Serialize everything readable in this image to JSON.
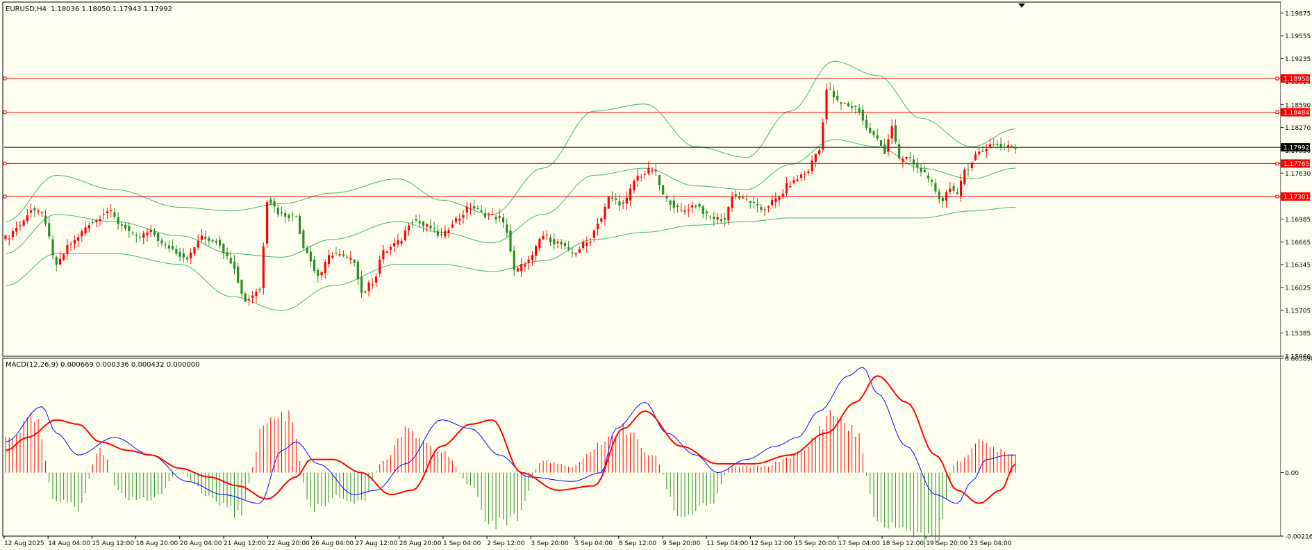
{
  "chart_data": [
    {
      "type": "candlestick",
      "title": "EURUSD,H4",
      "ohlc_readout": "1.18036 1.18050 1.17943 1.17992",
      "current_price": "1.17992",
      "y_tick_labels": [
        "1.19875",
        "1.19555",
        "1.19235",
        "1.18915",
        "1.18590",
        "1.18270",
        "1.17950",
        "1.17630",
        "1.17310",
        "1.16985",
        "1.16665",
        "1.16345",
        "1.16025",
        "1.15705",
        "1.15385",
        "1.15060"
      ],
      "ylim": [
        1.1506,
        1.2003
      ],
      "x_tick_labels": [
        "12 Aug 2025",
        "14 Aug 04:00",
        "15 Aug 12:00",
        "18 Aug 20:00",
        "20 Aug 04:00",
        "21 Aug 12:00",
        "22 Aug 20:00",
        "26 Aug 04:00",
        "27 Aug 12:00",
        "28 Aug 20:00",
        "1 Sep 04:00",
        "2 Sep 12:00",
        "3 Sep 20:00",
        "5 Sep 04:00",
        "8 Sep 12:00",
        "9 Sep 20:00",
        "11 Sep 04:00",
        "12 Sep 12:00",
        "15 Sep 20:00",
        "17 Sep 04:00",
        "18 Sep 12:00",
        "19 Sep 20:00",
        "23 Sep 04:00"
      ],
      "horizontal_lines": [
        {
          "value": 1.18958,
          "label": "1.18958",
          "color": "#ff0000"
        },
        {
          "value": 1.18484,
          "label": "1.18484",
          "color": "#ff0000"
        },
        {
          "value": 1.17765,
          "label": "1.17765",
          "color": "#ff0000"
        },
        {
          "value": 1.17301,
          "label": "1.17301",
          "color": "#ff0000"
        }
      ],
      "bollinger_anchor_mid": [
        [
          0,
          1.165
        ],
        [
          14,
          1.1705
        ],
        [
          30,
          1.1695
        ],
        [
          48,
          1.1675
        ],
        [
          62,
          1.165
        ],
        [
          76,
          1.1645
        ],
        [
          90,
          1.167
        ],
        [
          108,
          1.1695
        ],
        [
          120,
          1.168
        ],
        [
          134,
          1.1665
        ],
        [
          148,
          1.1705
        ],
        [
          162,
          1.176
        ],
        [
          176,
          1.177
        ],
        [
          190,
          1.1745
        ],
        [
          204,
          1.174
        ],
        [
          216,
          1.1775
        ],
        [
          228,
          1.181
        ],
        [
          240,
          1.18
        ],
        [
          252,
          1.177
        ],
        [
          266,
          1.1755
        ],
        [
          278,
          1.177
        ]
      ],
      "bollinger_anchor_width": [
        [
          0,
          0.0045
        ],
        [
          14,
          0.0055
        ],
        [
          30,
          0.0045
        ],
        [
          48,
          0.004
        ],
        [
          62,
          0.006
        ],
        [
          76,
          0.0075
        ],
        [
          90,
          0.0065
        ],
        [
          108,
          0.006
        ],
        [
          120,
          0.0045
        ],
        [
          134,
          0.004
        ],
        [
          148,
          0.0065
        ],
        [
          162,
          0.009
        ],
        [
          176,
          0.009
        ],
        [
          190,
          0.0055
        ],
        [
          204,
          0.0045
        ],
        [
          216,
          0.0075
        ],
        [
          228,
          0.011
        ],
        [
          240,
          0.01
        ],
        [
          252,
          0.007
        ],
        [
          266,
          0.0045
        ],
        [
          278,
          0.0055
        ]
      ],
      "close_anchors": [
        [
          0,
          1.1672
        ],
        [
          4,
          1.169
        ],
        [
          7,
          1.1712
        ],
        [
          10,
          1.1705
        ],
        [
          14,
          1.1635
        ],
        [
          18,
          1.1665
        ],
        [
          24,
          1.1695
        ],
        [
          28,
          1.171
        ],
        [
          32,
          1.169
        ],
        [
          36,
          1.1672
        ],
        [
          40,
          1.168
        ],
        [
          44,
          1.166
        ],
        [
          50,
          1.1645
        ],
        [
          54,
          1.1672
        ],
        [
          58,
          1.1668
        ],
        [
          62,
          1.164
        ],
        [
          66,
          1.1585
        ],
        [
          70,
          1.16
        ],
        [
          72,
          1.1726
        ],
        [
          76,
          1.1705
        ],
        [
          80,
          1.1702
        ],
        [
          82,
          1.166
        ],
        [
          86,
          1.162
        ],
        [
          90,
          1.165
        ],
        [
          96,
          1.164
        ],
        [
          98,
          1.1595
        ],
        [
          101,
          1.161
        ],
        [
          104,
          1.1652
        ],
        [
          108,
          1.1665
        ],
        [
          112,
          1.1698
        ],
        [
          116,
          1.1688
        ],
        [
          120,
          1.1675
        ],
        [
          124,
          1.1698
        ],
        [
          128,
          1.1715
        ],
        [
          132,
          1.1705
        ],
        [
          136,
          1.17
        ],
        [
          138,
          1.1682
        ],
        [
          140,
          1.1625
        ],
        [
          144,
          1.164
        ],
        [
          148,
          1.1675
        ],
        [
          152,
          1.1665
        ],
        [
          156,
          1.165
        ],
        [
          160,
          1.1665
        ],
        [
          164,
          1.17
        ],
        [
          166,
          1.1728
        ],
        [
          170,
          1.172
        ],
        [
          174,
          1.1758
        ],
        [
          178,
          1.1768
        ],
        [
          182,
          1.1725
        ],
        [
          186,
          1.171
        ],
        [
          190,
          1.1718
        ],
        [
          194,
          1.17
        ],
        [
          198,
          1.1698
        ],
        [
          200,
          1.1732
        ],
        [
          204,
          1.1725
        ],
        [
          208,
          1.1712
        ],
        [
          212,
          1.1725
        ],
        [
          216,
          1.1748
        ],
        [
          220,
          1.1762
        ],
        [
          224,
          1.1795
        ],
        [
          226,
          1.188
        ],
        [
          230,
          1.186
        ],
        [
          234,
          1.1855
        ],
        [
          238,
          1.182
        ],
        [
          240,
          1.181
        ],
        [
          242,
          1.1793
        ],
        [
          244,
          1.183
        ],
        [
          246,
          1.178
        ],
        [
          248,
          1.1785
        ],
        [
          252,
          1.1768
        ],
        [
          254,
          1.1752
        ],
        [
          258,
          1.1725
        ],
        [
          260,
          1.1745
        ],
        [
          262,
          1.173
        ],
        [
          264,
          1.1768
        ],
        [
          268,
          1.1792
        ],
        [
          272,
          1.1805
        ],
        [
          274,
          1.18
        ],
        [
          278,
          1.1799
        ]
      ]
    },
    {
      "type": "line+bar",
      "title": "MACD(12,26,9) 0.000669 0.000336 0.000432 0.000000",
      "y_tick_labels": [
        "0.003898",
        "0.00",
        "-0.002165"
      ],
      "ylim": [
        -0.002165,
        0.003898
      ],
      "series": [
        {
          "color": "#0000ff",
          "anchors": [
            [
              0,
              0.00035
            ],
            [
              10,
              0.00075
            ],
            [
              14,
              0.00045
            ],
            [
              20,
              0.0002
            ],
            [
              30,
              0.0004
            ],
            [
              40,
              0.0002
            ],
            [
              50,
              -0.0001
            ],
            [
              60,
              -0.00025
            ],
            [
              70,
              -0.00035
            ],
            [
              76,
              0.00025
            ],
            [
              80,
              0.00035
            ],
            [
              86,
              0.0001
            ],
            [
              96,
              -0.00025
            ],
            [
              102,
              -0.0002
            ],
            [
              110,
              0.0001
            ],
            [
              120,
              0.0006
            ],
            [
              128,
              0.0005
            ],
            [
              136,
              0.0002
            ],
            [
              144,
              -5e-05
            ],
            [
              156,
              -0.0001
            ],
            [
              164,
              0.0
            ],
            [
              168,
              0.0005
            ],
            [
              176,
              0.0008
            ],
            [
              182,
              0.00045
            ],
            [
              190,
              0.0002
            ],
            [
              196,
              0.0
            ],
            [
              204,
              0.00015
            ],
            [
              212,
              0.0003
            ],
            [
              218,
              0.0004
            ],
            [
              224,
              0.0007
            ],
            [
              232,
              0.0011
            ],
            [
              236,
              0.0012
            ],
            [
              240,
              0.0009
            ],
            [
              248,
              0.0003
            ],
            [
              256,
              -0.00025
            ],
            [
              262,
              -0.00035
            ],
            [
              266,
              -0.0001
            ],
            [
              270,
              0.00015
            ],
            [
              276,
              0.0002
            ],
            [
              278,
              0.0002
            ]
          ]
        },
        {
          "color": "#ff0000",
          "anchors": [
            [
              0,
              0.00025
            ],
            [
              6,
              0.0004
            ],
            [
              14,
              0.0006
            ],
            [
              20,
              0.00055
            ],
            [
              26,
              0.00035
            ],
            [
              34,
              0.00025
            ],
            [
              40,
              0.0002
            ],
            [
              48,
              5e-05
            ],
            [
              56,
              -5e-05
            ],
            [
              64,
              -0.00015
            ],
            [
              72,
              -0.0003
            ],
            [
              80,
              -5e-05
            ],
            [
              84,
              0.00015
            ],
            [
              90,
              0.00015
            ],
            [
              98,
              0.0
            ],
            [
              106,
              -0.00025
            ],
            [
              112,
              -0.0002
            ],
            [
              120,
              0.0003
            ],
            [
              128,
              0.00055
            ],
            [
              134,
              0.0006
            ],
            [
              142,
              0.0
            ],
            [
              152,
              -0.0002
            ],
            [
              162,
              -0.00015
            ],
            [
              170,
              0.0005
            ],
            [
              176,
              0.0007
            ],
            [
              186,
              0.0003
            ],
            [
              196,
              0.0001
            ],
            [
              206,
              0.0001
            ],
            [
              216,
              0.0002
            ],
            [
              226,
              0.00045
            ],
            [
              234,
              0.0008
            ],
            [
              240,
              0.0011
            ],
            [
              248,
              0.0008
            ],
            [
              256,
              0.0002
            ],
            [
              262,
              -0.0002
            ],
            [
              268,
              -0.00035
            ],
            [
              274,
              -0.0002
            ],
            [
              278,
              0.0001
            ]
          ]
        }
      ],
      "histogram_anchors": [
        [
          0,
          0.0012
        ],
        [
          8,
          0.0018
        ],
        [
          14,
          -0.001
        ],
        [
          20,
          -0.0012
        ],
        [
          26,
          0.0008
        ],
        [
          32,
          -0.0008
        ],
        [
          40,
          -0.001
        ],
        [
          48,
          0.0
        ],
        [
          56,
          -0.0008
        ],
        [
          64,
          -0.0014
        ],
        [
          72,
          0.0018
        ],
        [
          78,
          0.002
        ],
        [
          84,
          -0.0012
        ],
        [
          92,
          -0.0008
        ],
        [
          98,
          -0.001
        ],
        [
          104,
          0.0004
        ],
        [
          110,
          0.0014
        ],
        [
          120,
          0.0008
        ],
        [
          128,
          -0.0004
        ],
        [
          134,
          -0.0018
        ],
        [
          140,
          -0.0016
        ],
        [
          148,
          0.0004
        ],
        [
          156,
          0.0002
        ],
        [
          164,
          0.001
        ],
        [
          170,
          0.0015
        ],
        [
          178,
          0.0006
        ],
        [
          186,
          -0.0016
        ],
        [
          194,
          -0.001
        ],
        [
          200,
          0.0002
        ],
        [
          208,
          0.0002
        ],
        [
          218,
          0.0006
        ],
        [
          228,
          0.002
        ],
        [
          234,
          0.0014
        ],
        [
          240,
          -0.0016
        ],
        [
          248,
          -0.002
        ],
        [
          256,
          -0.0024
        ],
        [
          262,
          0.0004
        ],
        [
          268,
          0.001
        ],
        [
          274,
          0.0008
        ],
        [
          278,
          0.0006
        ]
      ]
    }
  ]
}
